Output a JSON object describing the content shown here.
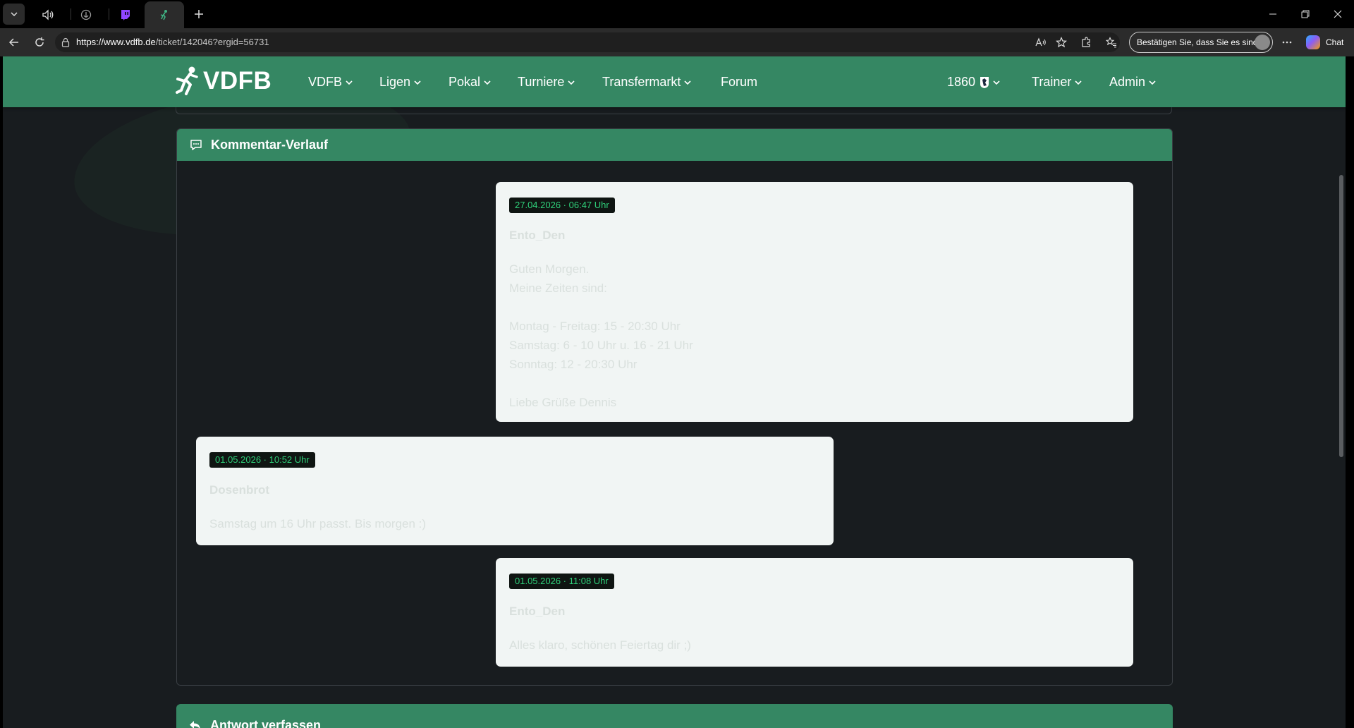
{
  "browser": {
    "tabs": [
      {
        "name": "tab-audio",
        "icon": "speaker-icon"
      },
      {
        "name": "tab-anchor",
        "icon": "anchor-icon"
      },
      {
        "name": "tab-twitch",
        "icon": "twitch-icon"
      },
      {
        "name": "tab-vdfb",
        "icon": "vdfb-logo-icon",
        "active": true
      }
    ],
    "url_host": "https://www.vdfb.de",
    "url_path": "/ticket/142046?ergid=56731",
    "confirm_label": "Bestätigen Sie, dass Sie es sind",
    "chat_label": "Chat"
  },
  "site": {
    "brand": "VDFB",
    "menu": [
      {
        "label": "VDFB",
        "dropdown": true
      },
      {
        "label": "Ligen",
        "dropdown": true
      },
      {
        "label": "Pokal",
        "dropdown": true
      },
      {
        "label": "Turniere",
        "dropdown": true
      },
      {
        "label": "Transfermarkt",
        "dropdown": true
      },
      {
        "label": "Forum",
        "dropdown": false
      }
    ],
    "right_menu": [
      {
        "label": "1860",
        "dropdown": true,
        "has_crest": true
      },
      {
        "label": "Trainer",
        "dropdown": true
      },
      {
        "label": "Admin",
        "dropdown": true
      }
    ]
  },
  "comments_card": {
    "title": "Kommentar-Verlauf",
    "comments": [
      {
        "timestamp": "27.04.2026 · 06:47 Uhr",
        "author": "Ento_Den",
        "lines": [
          "Guten Morgen.",
          "Meine Zeiten sind:",
          "",
          "Montag - Freitag: 15 - 20:30 Uhr",
          "Samstag: 6 - 10 Uhr u. 16 - 21 Uhr",
          "Sonntag: 12 - 20:30 Uhr",
          "",
          "Liebe Grüße Dennis"
        ]
      },
      {
        "timestamp": "01.05.2026 · 10:52 Uhr",
        "author": "Dosenbrot",
        "lines": [
          "Samstag um 16 Uhr passt. Bis morgen :)"
        ]
      },
      {
        "timestamp": "01.05.2026 · 11:08 Uhr",
        "author": "Ento_Den",
        "lines": [
          "Alles klaro, schönen Feiertag dir ;)"
        ]
      }
    ]
  },
  "reply_card": {
    "title": "Antwort verfassen"
  },
  "colors": {
    "brand_green": "#358763",
    "page_bg": "#181c1f",
    "timestamp_text": "#2fd07a",
    "bubble_bg": "#f1f5f4"
  }
}
